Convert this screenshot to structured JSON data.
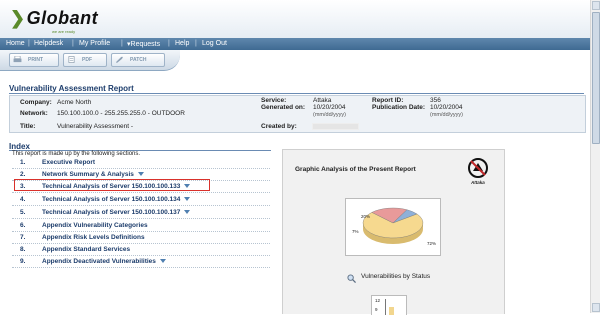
{
  "brand": {
    "name": "Globant",
    "tagline": "we are ready"
  },
  "nav": [
    "Home",
    "Helpdesk",
    "My Profile",
    "Requests",
    "Help",
    "Log Out"
  ],
  "toolbar": {
    "print": "PRINT",
    "pdf": "PDF",
    "patch": "PATCH"
  },
  "report": {
    "title": "Vulnerability Assessment Report",
    "company_label": "Company:",
    "company": "Acme North",
    "network_label": "Network:",
    "network": "150.100.100.0 - 255.255.255.0 - OUTDOOR",
    "title_label": "Title:",
    "report_title": "Vulnerability Assessment -",
    "service_label": "Service:",
    "service": "Attaka",
    "generated_label": "Generated on:",
    "generated": "10/20/2004",
    "generated_hint": "(mm/dd/yyyy)",
    "created_label": "Created by:",
    "reportid_label": "Report ID:",
    "reportid": "356",
    "pubdate_label": "Publication Date:",
    "pubdate": "10/20/2004",
    "pubdate_hint": "(mm/dd/yyyy)"
  },
  "index": {
    "title": "Index",
    "intro": "This report is made up by the following sections.",
    "items": [
      {
        "num": "1.",
        "label": "Executive Report",
        "dropdown": false
      },
      {
        "num": "2.",
        "label": "Network Summary & Analysis",
        "dropdown": true
      },
      {
        "num": "3.",
        "label": "Technical Analysis of Server 150.100.100.133",
        "dropdown": true
      },
      {
        "num": "4.",
        "label": "Technical Analysis of Server 150.100.100.134",
        "dropdown": true
      },
      {
        "num": "5.",
        "label": "Technical Analysis of Server 150.100.100.137",
        "dropdown": true
      },
      {
        "num": "6.",
        "label": "Appendix Vulnerability Categories",
        "dropdown": false
      },
      {
        "num": "7.",
        "label": "Appendix Risk Levels Definitions",
        "dropdown": false
      },
      {
        "num": "8.",
        "label": "Appendix Standard Services",
        "dropdown": false
      },
      {
        "num": "9.",
        "label": "Appendix Deactivated Vulnerabilities",
        "dropdown": true
      }
    ],
    "highlighted": 3
  },
  "panel": {
    "title": "Graphic Analysis of the Present Report",
    "brand_label": "Attaka",
    "pie": {
      "labels": [
        "20%",
        "7%",
        "72%"
      ],
      "values": [
        20,
        7,
        72
      ]
    },
    "status_label": "Vulnerabilities by Status",
    "bar_labels": [
      "12",
      "9"
    ]
  },
  "colors": {
    "accent": "#1c3c6b",
    "nav": "#4f77a0",
    "highlight": "#d9312b"
  }
}
